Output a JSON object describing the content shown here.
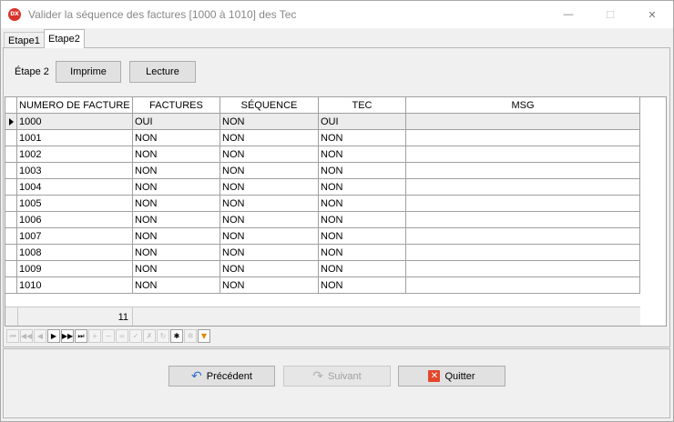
{
  "window": {
    "icon_text": "DX",
    "title": "Valider la séquence des factures [1000 à 1010] des Tec",
    "minimize": "—",
    "maximize": "☐",
    "close": "✕"
  },
  "tabs": [
    {
      "label": "Etape1",
      "active": false
    },
    {
      "label": "Etape2",
      "active": true
    }
  ],
  "step": {
    "label": "Étape 2",
    "print_label": "Imprime",
    "read_label": "Lecture"
  },
  "grid": {
    "columns": [
      "NUMERO DE FACTURE",
      "FACTURES",
      "SÉQUENCE",
      "TEC",
      "MSG"
    ],
    "rows": [
      [
        "1000",
        "OUI",
        "NON",
        "OUI",
        ""
      ],
      [
        "1001",
        "NON",
        "NON",
        "NON",
        ""
      ],
      [
        "1002",
        "NON",
        "NON",
        "NON",
        ""
      ],
      [
        "1003",
        "NON",
        "NON",
        "NON",
        ""
      ],
      [
        "1004",
        "NON",
        "NON",
        "NON",
        ""
      ],
      [
        "1005",
        "NON",
        "NON",
        "NON",
        ""
      ],
      [
        "1006",
        "NON",
        "NON",
        "NON",
        ""
      ],
      [
        "1007",
        "NON",
        "NON",
        "NON",
        ""
      ],
      [
        "1008",
        "NON",
        "NON",
        "NON",
        ""
      ],
      [
        "1009",
        "NON",
        "NON",
        "NON",
        ""
      ],
      [
        "1010",
        "NON",
        "NON",
        "NON",
        ""
      ]
    ],
    "selected_row": 0,
    "row_count": "11"
  },
  "navigator": [
    {
      "name": "first-page-icon",
      "glyph": "⏮",
      "enabled": false
    },
    {
      "name": "prior-page-icon",
      "glyph": "◀◀",
      "enabled": false
    },
    {
      "name": "prior-record-icon",
      "glyph": "◀",
      "enabled": false
    },
    {
      "name": "next-record-icon",
      "glyph": "▶",
      "enabled": true
    },
    {
      "name": "next-page-icon",
      "glyph": "▶▶",
      "enabled": true
    },
    {
      "name": "last-record-icon",
      "glyph": "⏭",
      "enabled": true
    },
    {
      "name": "append-icon",
      "glyph": "+",
      "enabled": false
    },
    {
      "name": "delete-icon",
      "glyph": "−",
      "enabled": false
    },
    {
      "name": "remove-icon",
      "glyph": "=",
      "enabled": false
    },
    {
      "name": "edit-icon",
      "glyph": "✓",
      "enabled": false
    },
    {
      "name": "cancel-edit-icon",
      "glyph": "✗",
      "enabled": false
    },
    {
      "name": "refresh-icon",
      "glyph": "↻",
      "enabled": false
    },
    {
      "name": "bookmark-icon",
      "glyph": "✱",
      "enabled": true
    },
    {
      "name": "goto-bookmark-icon",
      "glyph": "✲",
      "enabled": false
    },
    {
      "name": "filter-icon",
      "glyph": "▼",
      "enabled": true
    }
  ],
  "actions": {
    "previous_label": "Précédent",
    "next_label": "Suivant",
    "quit_label": "Quitter",
    "previous_icon": "↶",
    "next_icon": "↷",
    "quit_icon": "✕"
  },
  "colors": {
    "accent_undo": "#2f6fd6",
    "quit_red": "#e2472c",
    "filter_orange": "#e08a00",
    "app_icon_red": "#d9342b"
  }
}
